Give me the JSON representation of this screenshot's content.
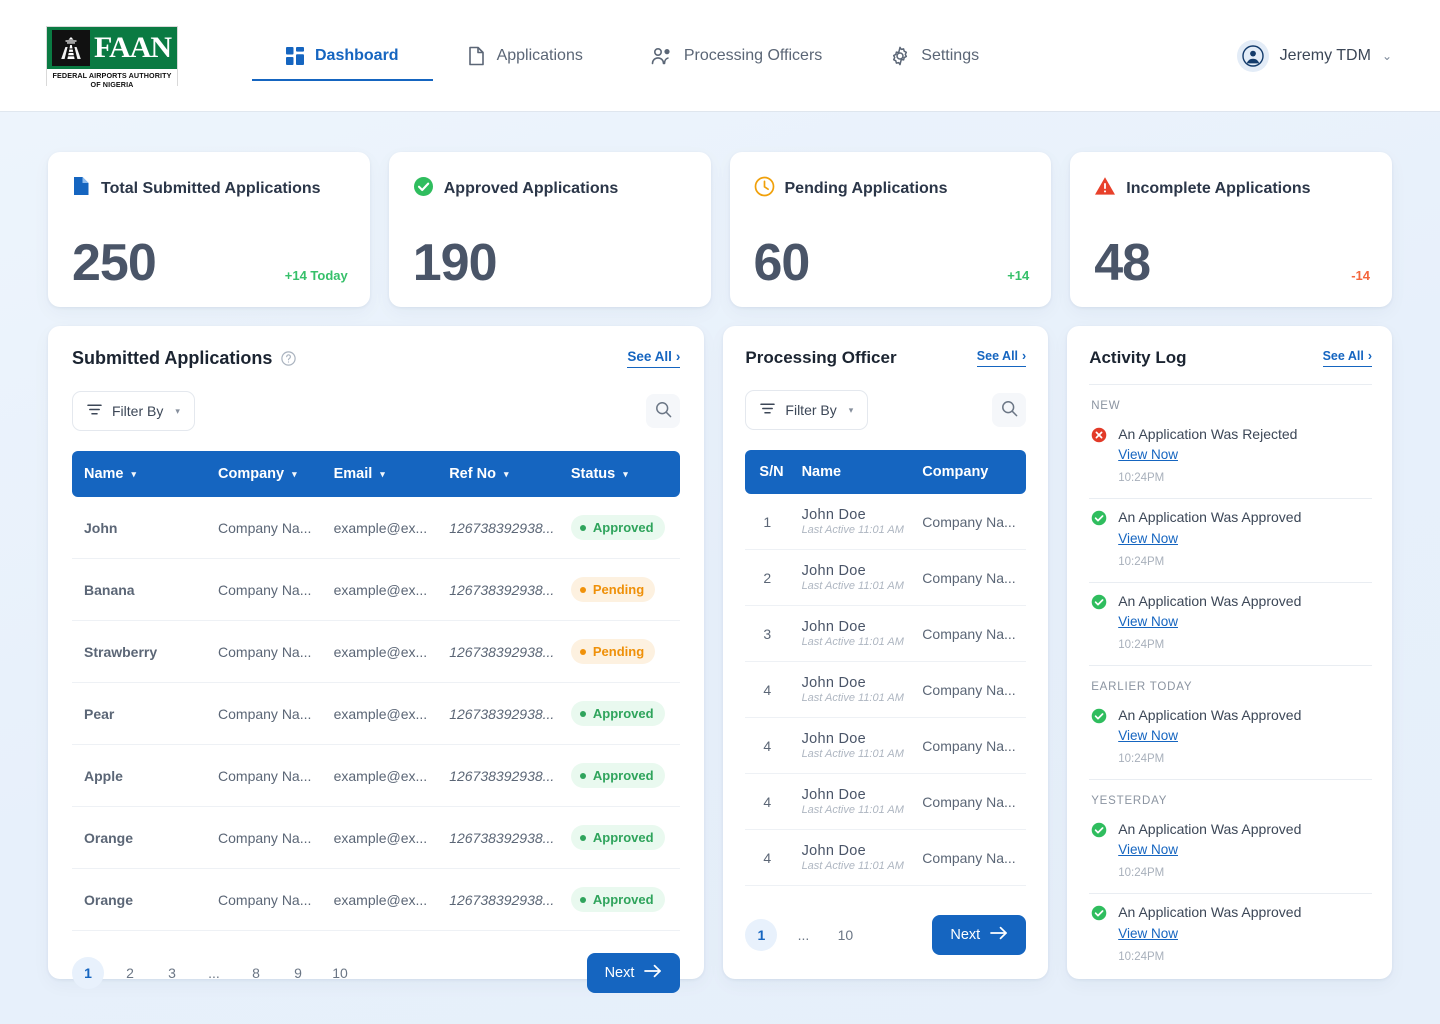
{
  "brand": {
    "logo_word": "FAAN",
    "logo_subtitle": "FEDERAL AIRPORTS AUTHORITY OF NIGERIA",
    "accent_blue": "#1565c0",
    "green": "#0a7a42"
  },
  "nav": {
    "items": [
      {
        "label": "Dashboard",
        "icon": "grid-icon",
        "active": true
      },
      {
        "label": "Applications",
        "icon": "document-icon",
        "active": false
      },
      {
        "label": "Processing Officers",
        "icon": "users-icon",
        "active": false
      },
      {
        "label": "Settings",
        "icon": "gear-icon",
        "active": false
      }
    ],
    "user": {
      "name": "Jeremy TDM",
      "caret": "⌄"
    }
  },
  "stats": [
    {
      "title": "Total Submitted Applications",
      "value": "250",
      "delta": "+14 Today",
      "delta_dir": "up",
      "icon": "document-blue-icon",
      "color": "#1565c0"
    },
    {
      "title": "Approved Applications",
      "value": "190",
      "delta": "",
      "delta_dir": "none",
      "icon": "check-circle-icon",
      "color": "#2fa45c"
    },
    {
      "title": "Pending Applications",
      "value": "60",
      "delta": "+14",
      "delta_dir": "up",
      "icon": "clock-icon",
      "color": "#f0920a"
    },
    {
      "title": "Incomplete Applications",
      "value": "48",
      "delta": "-14",
      "delta_dir": "down",
      "icon": "warning-triangle-icon",
      "color": "#e8402a"
    }
  ],
  "submitted": {
    "title": "Submitted Applications",
    "help_icon": "question-circle-icon",
    "see_all": "See All",
    "filter_label": "Filter By",
    "search_icon": "search-icon",
    "columns": [
      "Name",
      "Company",
      "Email",
      "Ref No",
      "Status"
    ],
    "rows": [
      {
        "name": "John",
        "company": "Company Na...",
        "email": "example@ex...",
        "ref": "126738392938...",
        "status": "Approved"
      },
      {
        "name": "Banana",
        "company": "Company Na...",
        "email": "example@ex...",
        "ref": "126738392938...",
        "status": "Pending"
      },
      {
        "name": "Strawberry",
        "company": "Company Na...",
        "email": "example@ex...",
        "ref": "126738392938...",
        "status": "Pending"
      },
      {
        "name": "Pear",
        "company": "Company Na...",
        "email": "example@ex...",
        "ref": "126738392938...",
        "status": "Approved"
      },
      {
        "name": "Apple",
        "company": "Company Na...",
        "email": "example@ex...",
        "ref": "126738392938...",
        "status": "Approved"
      },
      {
        "name": "Orange",
        "company": "Company Na...",
        "email": "example@ex...",
        "ref": "126738392938...",
        "status": "Approved"
      },
      {
        "name": "Orange",
        "company": "Company Na...",
        "email": "example@ex...",
        "ref": "126738392938...",
        "status": "Approved"
      }
    ],
    "pagination": {
      "pages": [
        "1",
        "2",
        "3",
        "...",
        "8",
        "9",
        "10"
      ],
      "current": "1",
      "next_label": "Next"
    }
  },
  "officer": {
    "title": "Processing Officer",
    "see_all": "See All",
    "filter_label": "Filter By",
    "search_icon": "search-icon",
    "columns": [
      "S/N",
      "Name",
      "Company"
    ],
    "rows": [
      {
        "sn": "1",
        "name": "John Doe",
        "last_active": "Last Active 11:01 AM",
        "company": "Company Na..."
      },
      {
        "sn": "2",
        "name": "John Doe",
        "last_active": "Last Active 11:01 AM",
        "company": "Company Na..."
      },
      {
        "sn": "3",
        "name": "John Doe",
        "last_active": "Last Active 11:01 AM",
        "company": "Company Na..."
      },
      {
        "sn": "4",
        "name": "John Doe",
        "last_active": "Last Active 11:01 AM",
        "company": "Company Na..."
      },
      {
        "sn": "4",
        "name": "John Doe",
        "last_active": "Last Active 11:01 AM",
        "company": "Company Na..."
      },
      {
        "sn": "4",
        "name": "John Doe",
        "last_active": "Last Active 11:01 AM",
        "company": "Company Na..."
      },
      {
        "sn": "4",
        "name": "John Doe",
        "last_active": "Last Active 11:01 AM",
        "company": "Company Na..."
      }
    ],
    "pagination": {
      "pages": [
        "1",
        "...",
        "10"
      ],
      "current": "1",
      "next_label": "Next"
    }
  },
  "activity": {
    "title": "Activity Log",
    "see_all": "See All",
    "groups": [
      {
        "label": "NEW",
        "items": [
          {
            "text": "An Application Was Rejected",
            "link": "View Now",
            "time": "10:24PM",
            "type": "rejected"
          },
          {
            "text": "An Application Was Approved",
            "link": "View Now",
            "time": "10:24PM",
            "type": "approved"
          },
          {
            "text": "An Application Was Approved",
            "link": "View Now",
            "time": "10:24PM",
            "type": "approved"
          }
        ]
      },
      {
        "label": "EARLIER TODAY",
        "items": [
          {
            "text": "An Application Was Approved",
            "link": "View Now",
            "time": "10:24PM",
            "type": "approved"
          }
        ]
      },
      {
        "label": "YESTERDAY",
        "items": [
          {
            "text": "An Application Was Approved",
            "link": "View Now",
            "time": "10:24PM",
            "type": "approved"
          },
          {
            "text": "An Application Was Approved",
            "link": "View Now",
            "time": "10:24PM",
            "type": "approved"
          }
        ]
      }
    ]
  }
}
